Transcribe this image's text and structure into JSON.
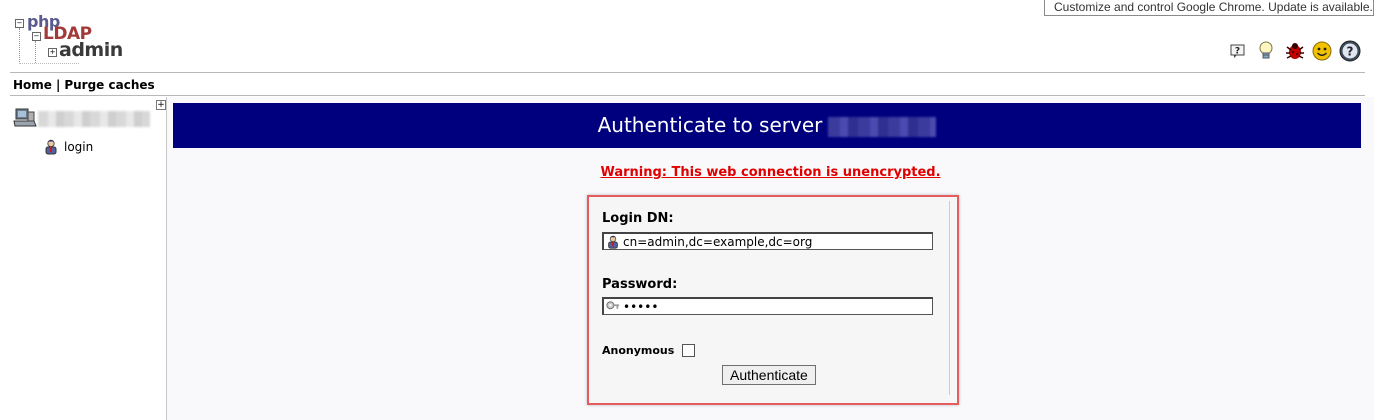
{
  "chrome_tooltip": "Customize and control Google Chrome. Update is available.",
  "logo": {
    "php": "php",
    "ldap": "LDAP",
    "admin": "admin"
  },
  "header_icons": [
    "help-icon",
    "light-bulb-icon",
    "bug-icon",
    "smiley-icon",
    "question-icon"
  ],
  "menu": {
    "home": "Home",
    "separator": "|",
    "purge": "Purge caches"
  },
  "tree": {
    "expand": "+",
    "login_label": "login"
  },
  "main": {
    "title": "Authenticate to server",
    "warning": "Warning: This web connection is unencrypted.",
    "form": {
      "login_dn_label": "Login DN:",
      "login_dn_value": "cn=admin,dc=example,dc=org",
      "password_label": "Password:",
      "password_value": "•••••",
      "anonymous_label": "Anonymous",
      "anonymous_checked": false,
      "authenticate_button": "Authenticate"
    }
  },
  "colors": {
    "title_bar": "#00007f",
    "warning": "#e00000",
    "highlight_border": "#e45c5c"
  }
}
